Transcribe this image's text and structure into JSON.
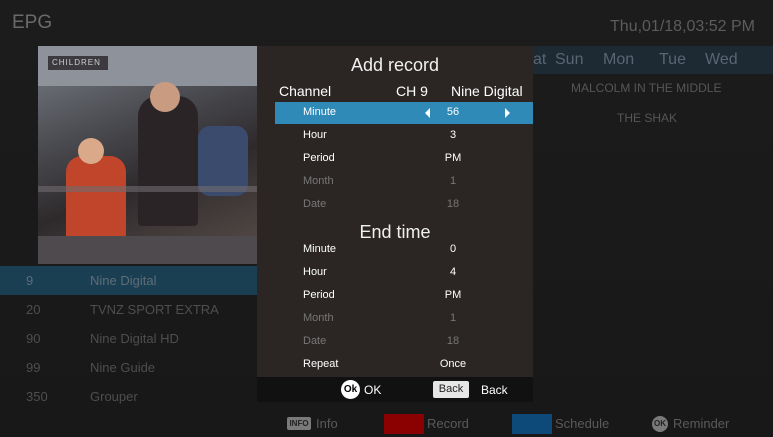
{
  "header": {
    "title": "EPG",
    "clock": "Thu,01/18,03:52 PM"
  },
  "preview": {
    "watermark": "CHILDREN"
  },
  "channels": [
    {
      "num": "9",
      "name": "Nine Digital"
    },
    {
      "num": "20",
      "name": "TVNZ SPORT EXTRA"
    },
    {
      "num": "90",
      "name": "Nine Digital HD"
    },
    {
      "num": "99",
      "name": "Nine Guide"
    },
    {
      "num": "350",
      "name": "Grouper"
    }
  ],
  "epg": {
    "days": [
      "at",
      "Sun",
      "Mon",
      "Tue",
      "Wed"
    ],
    "programs": [
      "MALCOLM IN THE MIDDLE",
      "THE SHAK"
    ]
  },
  "dialog": {
    "title": "Add record",
    "channel_label": "Channel",
    "channel_number": "CH 9",
    "channel_name": "Nine Digital",
    "start": [
      {
        "label": "Minute",
        "value": "56"
      },
      {
        "label": "Hour",
        "value": "3"
      },
      {
        "label": "Period",
        "value": "PM"
      },
      {
        "label": "Month",
        "value": "1"
      },
      {
        "label": "Date",
        "value": "18"
      }
    ],
    "end_title": "End time",
    "end": [
      {
        "label": "Minute",
        "value": "0"
      },
      {
        "label": "Hour",
        "value": "4"
      },
      {
        "label": "Period",
        "value": "PM"
      },
      {
        "label": "Month",
        "value": "1"
      },
      {
        "label": "Date",
        "value": "18"
      },
      {
        "label": "Repeat",
        "value": "Once"
      }
    ],
    "ok_icon": "Ok",
    "ok_label": "OK",
    "back_button": "Back",
    "back_label": "Back"
  },
  "footer": {
    "info_badge": "INFO",
    "info_label": "Info",
    "record_label": "Record",
    "schedule_label": "Schedule",
    "ok_badge": "OK",
    "reminder_label": "Reminder"
  },
  "colors": {
    "record": "#8b0000",
    "schedule": "#0d4a7a",
    "selected_row": "#2f8ab8",
    "dialog_bg": "#2b2624"
  }
}
